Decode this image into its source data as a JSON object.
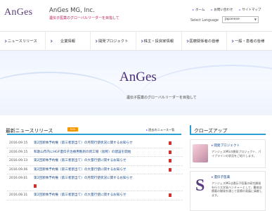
{
  "header": {
    "logo": "AnGes",
    "company_name": "AnGes MG, Inc.",
    "tagline": "遺伝子医薬のグローバルリーダーを目指して",
    "top_links": [
      "ホーム",
      "お問い合わせ",
      "サイトマップ"
    ],
    "language_label": "Select Language",
    "language_value": "Japanese"
  },
  "nav": {
    "items": [
      "ニュースリリース",
      "企業情報",
      "開発プロジェクト",
      "株主・投資家情報",
      "医療関係者の皆様",
      "一般・患者の皆様"
    ]
  },
  "hero": {
    "logo": "AnGes",
    "tagline": "遺伝子医薬のグローバルリーダーを目指して"
  },
  "news": {
    "title": "最新ニュースリリース",
    "rss_label": "RSS",
    "list_link": "過去のニュース一覧",
    "items": [
      {
        "date": "2016.09.15",
        "text": "第2回新株予約権（第三者割当て）の月間行使状況に関するお知らせ"
      },
      {
        "date": "2016.09.15",
        "text": "和歌山市内にHGF遺伝子治療用製剤の新工場（仮称）の建設を開始"
      },
      {
        "date": "2016.09.13",
        "text": "第2回新株予約権（第三者割当て）の大量行使に関するお知らせ"
      },
      {
        "date": "2016.09.06",
        "text": "第2回新株予約権（第三者割当て）の大量行使に関するお知らせ"
      },
      {
        "date": "2016.09.01",
        "text": "第2回新株予約権（第三者割当て）の月間行使状況に関するお知らせ"
      },
      {
        "date": "2016.08.31",
        "text": "第2回新株予約権（第三者割当て）の大量行使に関するお知らせ"
      }
    ]
  },
  "closeup": {
    "title": "クローズアップ",
    "cards": [
      {
        "title": "開発プロジェクト",
        "desc": "アンジェスMGの開発プロジェクト、パイプラインの状況をご紹介します。"
      },
      {
        "title": "遺伝子医薬",
        "desc": "アンジェスMGは遺伝子医薬の研究開発を行う大学発ベンチャーとして、難病治療薬の開発を通じて医療の発展に貢献します。"
      }
    ]
  },
  "colors": {
    "accent_blue": "#2a9fd6",
    "brand_purple": "#5a3a80",
    "brand_pink": "#c2185b",
    "rss_orange": "#f39800",
    "pdf_red": "#d32f2f"
  }
}
